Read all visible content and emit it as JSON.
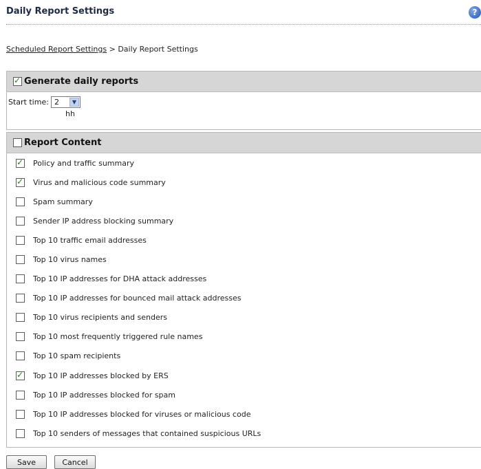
{
  "page": {
    "title": "Daily Report Settings",
    "help_icon": "help-icon",
    "help_glyph": "?"
  },
  "breadcrumb": {
    "link_label": "Scheduled Report Settings",
    "separator": " > ",
    "current": "Daily Report Settings"
  },
  "generate": {
    "label": "Generate daily reports",
    "checked": true,
    "start_time_label": "Start time:",
    "start_time_value": "2",
    "unit_label": "hh"
  },
  "report_content": {
    "label": "Report Content",
    "checked": false,
    "items": [
      {
        "label": "Policy and traffic summary",
        "checked": true
      },
      {
        "label": "Virus and malicious code summary",
        "checked": true
      },
      {
        "label": "Spam summary",
        "checked": false
      },
      {
        "label": "Sender IP address blocking summary",
        "checked": false
      },
      {
        "label": "Top 10 traffic email addresses",
        "checked": false
      },
      {
        "label": "Top 10 virus names",
        "checked": false
      },
      {
        "label": "Top 10 IP addresses for DHA attack addresses",
        "checked": false
      },
      {
        "label": "Top 10 IP addresses for bounced mail attack addresses",
        "checked": false
      },
      {
        "label": "Top 10 virus recipients and senders",
        "checked": false
      },
      {
        "label": "Top 10 most frequently triggered rule names",
        "checked": false
      },
      {
        "label": "Top 10 spam recipients",
        "checked": false
      },
      {
        "label": "Top 10 IP addresses blocked by ERS",
        "checked": true
      },
      {
        "label": "Top 10 IP addresses blocked for spam",
        "checked": false
      },
      {
        "label": "Top 10 IP addresses blocked for viruses or malicious code",
        "checked": false
      },
      {
        "label": "Top 10 senders of messages that contained suspicious URLs",
        "checked": false
      }
    ]
  },
  "actions": {
    "save_label": "Save",
    "cancel_label": "Cancel"
  }
}
